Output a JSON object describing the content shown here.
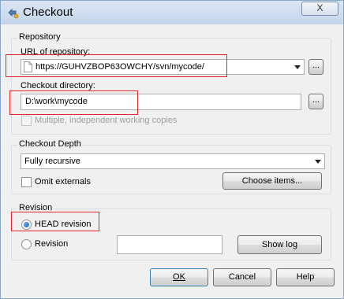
{
  "window": {
    "title": "Checkout",
    "close_glyph": "X"
  },
  "repository": {
    "group_title": "Repository",
    "url_label": "URL of repository:",
    "url_value": "https://GUHVZBOP63OWCHY/svn/mycode/",
    "browse_label": "...",
    "dir_label": "Checkout directory:",
    "dir_value": "D:\\work\\mycode",
    "dir_browse_label": "...",
    "multiple_label": "Multiple, independent working copies",
    "multiple_checked": false,
    "multiple_enabled": false
  },
  "depth": {
    "group_title": "Checkout Depth",
    "selected": "Fully recursive",
    "omit_externals_label": "Omit externals",
    "omit_externals_checked": false,
    "choose_items_label": "Choose items..."
  },
  "revision": {
    "group_title": "Revision",
    "head_label": "HEAD revision",
    "head_selected": true,
    "revision_label": "Revision",
    "revision_value": "",
    "show_log_label": "Show log"
  },
  "footer": {
    "ok_label": "OK",
    "cancel_label": "Cancel",
    "help_label": "Help"
  },
  "colors": {
    "highlight_border": "#e3242b",
    "title_bar": "#c4d5eb"
  },
  "icons": {
    "title": "checkout-icon",
    "url_field": "document-icon"
  }
}
